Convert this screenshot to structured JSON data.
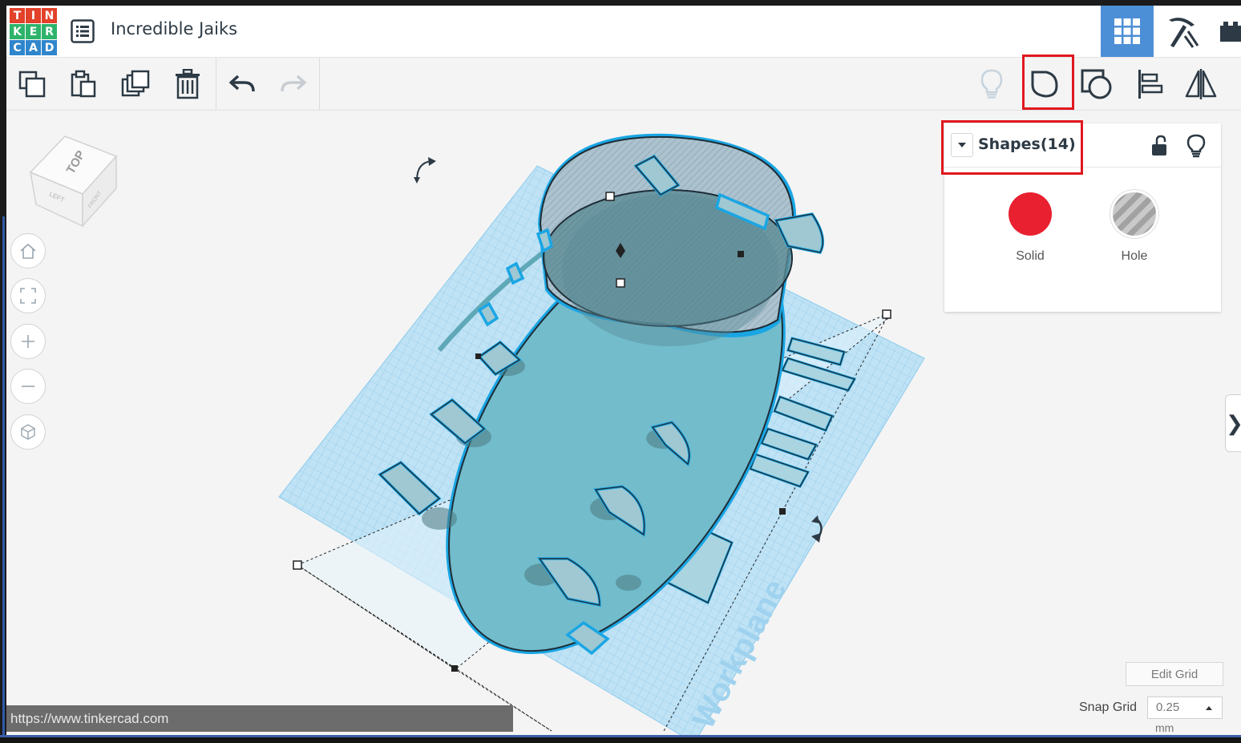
{
  "brand": {
    "logo_letters": [
      "T",
      "I",
      "N",
      "K",
      "E",
      "R",
      "C",
      "A",
      "D"
    ],
    "logo_colors": [
      "#e2412a",
      "#e2412a",
      "#e2412a",
      "#2eb36b",
      "#2eb36b",
      "#2eb36b",
      "#2f86cc",
      "#2f86cc",
      "#2f86cc"
    ]
  },
  "header": {
    "design_title": "Incredible Jaiks",
    "views": [
      {
        "name": "3d-design-view",
        "icon": "grid-icon",
        "active": true
      },
      {
        "name": "build-view",
        "icon": "pickaxe-icon",
        "active": false
      },
      {
        "name": "blocks-view",
        "icon": "blocks-icon",
        "active": false
      }
    ]
  },
  "toolbar": {
    "left_tools": [
      "copy-icon",
      "paste-icon",
      "duplicate-icon",
      "delete-icon",
      "undo-icon",
      "redo-icon"
    ],
    "right_tools": [
      "notes-bulb-icon",
      "group-icon",
      "ungroup-icon",
      "align-icon",
      "mirror-icon"
    ],
    "highlighted_tool": "group-icon"
  },
  "view_cube": {
    "faces": [
      "TOP",
      "LEFT",
      "FRONT"
    ]
  },
  "nav_controls": [
    "home-icon",
    "fit-view-icon",
    "zoom-in-icon",
    "zoom-out-icon",
    "perspective-icon"
  ],
  "inspector": {
    "title": "Shapes(14)",
    "options": [
      {
        "label": "Solid",
        "color": "#e8202f"
      },
      {
        "label": "Hole",
        "color": "#b9b9b9"
      }
    ]
  },
  "workplane": {
    "watermark": "Workplane"
  },
  "grid": {
    "edit_label": "Edit Grid",
    "snap_label": "Snap Grid",
    "snap_value": "0.25",
    "snap_unit": "mm"
  },
  "status_bar": {
    "url": "https://www.tinkercad.com"
  },
  "colors": {
    "accent": "#4d8fd6",
    "highlight_border": "#e0181f",
    "shape_fill": "#6fbccd",
    "selection_outline": "#1aa6e4"
  }
}
